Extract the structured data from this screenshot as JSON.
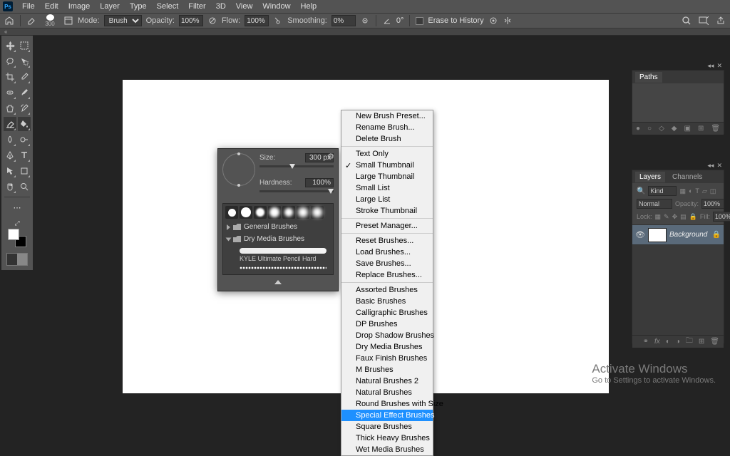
{
  "menubar": {
    "items": [
      "File",
      "Edit",
      "Image",
      "Layer",
      "Type",
      "Select",
      "Filter",
      "3D",
      "View",
      "Window",
      "Help"
    ]
  },
  "optbar": {
    "brush_size": "300",
    "mode_label": "Mode:",
    "mode_value": "Brush",
    "opacity_label": "Opacity:",
    "opacity_value": "100%",
    "flow_label": "Flow:",
    "flow_value": "100%",
    "smoothing_label": "Smoothing:",
    "smoothing_value": "0%",
    "angle_value": "0°",
    "erase_label": "Erase to History"
  },
  "brushpanel": {
    "size_label": "Size:",
    "size_value": "300 px",
    "hardness_label": "Hardness:",
    "hardness_value": "100%",
    "folder_general": "General Brushes",
    "folder_drymedia": "Dry Media Brushes",
    "brush_name": "KYLE Ultimate Pencil Hard"
  },
  "ctxmenu": {
    "g1": [
      "New Brush Preset...",
      "Rename Brush...",
      "Delete Brush"
    ],
    "g2": [
      "Text Only",
      "Small Thumbnail",
      "Large Thumbnail",
      "Small List",
      "Large List",
      "Stroke Thumbnail"
    ],
    "g2_checked": 1,
    "g3": [
      "Preset Manager..."
    ],
    "g4": [
      "Reset Brushes...",
      "Load Brushes...",
      "Save Brushes...",
      "Replace Brushes..."
    ],
    "g5": [
      "Assorted Brushes",
      "Basic Brushes",
      "Calligraphic Brushes",
      "DP Brushes",
      "Drop Shadow Brushes",
      "Dry Media Brushes",
      "Faux Finish Brushes",
      "M Brushes",
      "Natural Brushes 2",
      "Natural Brushes",
      "Round Brushes with Size",
      "Special Effect Brushes",
      "Square Brushes",
      "Thick Heavy Brushes",
      "Wet Media Brushes"
    ],
    "g5_selected": 11
  },
  "paths": {
    "tab": "Paths"
  },
  "layers": {
    "tab_layers": "Layers",
    "tab_channels": "Channels",
    "kind_label": "Kind",
    "blend_value": "Normal",
    "opacity_label": "Opacity:",
    "opacity_value": "100%",
    "lock_label": "Lock:",
    "fill_label": "Fill:",
    "fill_value": "100%",
    "bg_layer": "Background"
  },
  "watermark": {
    "title": "Activate Windows",
    "sub": "Go to Settings to activate Windows."
  }
}
